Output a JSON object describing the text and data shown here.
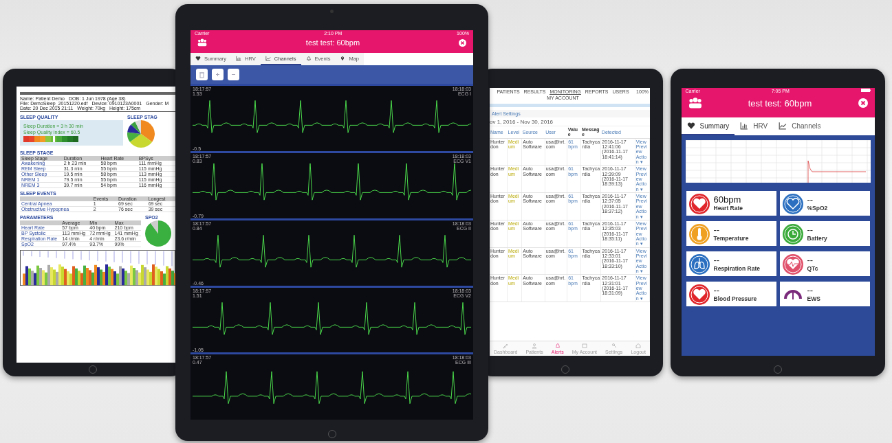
{
  "report_tablet": {
    "patient": [
      "Name: Patient Demo",
      "DOB: 1 Jun 1978 (Age 38)",
      "File: DemoSleep_20151220.edf",
      "Device: 0910123A0001",
      "Gender: M",
      "Date: 20 Dec 2015 21:11",
      "Weight: 70kg",
      "Height: 175cm"
    ],
    "sleep_quality": {
      "heading": "SLEEP QUALITY",
      "lines": [
        "Sleep Duration = 3 h 30 min",
        "Sleep Quality Index = 60.5"
      ],
      "level": 0.58
    },
    "sleep_stages_heading": "SLEEP STAG",
    "tables": [
      {
        "heading": "SLEEP STAGE",
        "columns": [
          "Sleep Stage",
          "Duration",
          "Heart Rate",
          "BPSys"
        ],
        "rows": [
          [
            "Awakening",
            "2 h 23 min",
            "58 bpm",
            "111 mmHg"
          ],
          [
            "REM Sleep",
            "31.3 min",
            "55 bpm",
            "115 mmHg"
          ],
          [
            "Other Sleep",
            "19.5 min",
            "58 bpm",
            "113 mmHg"
          ],
          [
            "NREM 1",
            "79.5 min",
            "55 bpm",
            "115 mmHg"
          ],
          [
            "NREM 3",
            "39.7 min",
            "54 bpm",
            "116 mmHg"
          ]
        ]
      },
      {
        "heading": "SLEEP EVENTS",
        "columns": [
          "",
          "Events",
          "Duration",
          "Longest"
        ],
        "rows": [
          [
            "Central Apnea",
            "1",
            "69 sec",
            "69 sec"
          ],
          [
            "Obstructive Hypopnea",
            "2",
            "76 sec",
            "39 sec"
          ]
        ]
      }
    ],
    "parameters": {
      "heading": "PARAMETERS",
      "columns": [
        "",
        "Average",
        "Min",
        "Max"
      ],
      "rows": [
        [
          "Heart Rate",
          "57 bpm",
          "40 bpm",
          "210 bpm"
        ],
        [
          "BP Systolic",
          "113 mmHg",
          "72 mmHg",
          "141 mmHg"
        ],
        [
          "Respiration Rate",
          "14 r/min",
          "4 r/min",
          "23.6 r/min"
        ],
        [
          "SpO2",
          "97.4%",
          "93.7%",
          "99%"
        ]
      ]
    },
    "spo2_heading": "SPO2"
  },
  "channels_tablet": {
    "status": {
      "carrier": "Carrier",
      "time": "2:10 PM",
      "battery": "100%"
    },
    "title": "test test: 60bpm",
    "tabs": [
      {
        "label": "Summary",
        "selected": false
      },
      {
        "label": "HRV",
        "selected": false
      },
      {
        "label": "Channels",
        "selected": true
      },
      {
        "label": "Events",
        "selected": false
      },
      {
        "label": "Map",
        "selected": false
      }
    ],
    "channels": [
      {
        "time_start": "18:17:57",
        "reading": "1.53",
        "time_end": "18:18:03",
        "lead": "ECG I",
        "scale": "-0.5"
      },
      {
        "time_start": "18:17:57",
        "reading": "0.83",
        "time_end": "18:18:03",
        "lead": "ECG V1",
        "scale": "-0.79"
      },
      {
        "time_start": "18:17:57",
        "reading": "0.84",
        "time_end": "18:18:03",
        "lead": "ECG II",
        "scale": "-0.46"
      },
      {
        "time_start": "18:17:57",
        "reading": "1.51",
        "time_end": "18:18:03",
        "lead": "ECG V2",
        "scale": "-1.05"
      },
      {
        "time_start": "18:17:57",
        "reading": "0.47",
        "time_end": "18:18:03",
        "lead": "ECG III"
      }
    ]
  },
  "alerts_tablet": {
    "battery": "100%",
    "nav": [
      {
        "label": "PATIENTS",
        "selected": false
      },
      {
        "label": "RESULTS",
        "selected": false
      },
      {
        "label": "MONITORING",
        "selected": true
      },
      {
        "label": "REPORTS",
        "selected": false
      },
      {
        "label": "USERS",
        "selected": false
      },
      {
        "label": "MY ACCOUNT",
        "selected": false
      }
    ],
    "breadcrumb": "Alert Settings",
    "date_range": "ov 1, 2016 - Nov 30, 2016",
    "columns": [
      "Name",
      "Level",
      "Source",
      "User",
      "Value",
      "Message",
      "Detected"
    ],
    "rows": [
      {
        "name": "Hunterdon",
        "level": "Medium",
        "source": "Auto Software",
        "user": "usa@hrt.com",
        "value": "61 bpm",
        "message": "Tachycardia",
        "detected": "2016-11-17 12:41:06",
        "detected_local": "(2016-11-17 18:41:14)",
        "actions": [
          "View",
          "Preview",
          "Action ▾"
        ]
      },
      {
        "name": "Hunterdon",
        "level": "Medium",
        "source": "Auto Software",
        "user": "usa@hrt.com",
        "value": "61 bpm",
        "message": "Tachycardia",
        "detected": "2016-11-17 12:39:09",
        "detected_local": "(2016-11-17 18:39:13)",
        "actions": [
          "View",
          "Preview",
          "Action ▾"
        ]
      },
      {
        "name": "Hunterdon",
        "level": "Medium",
        "source": "Auto Software",
        "user": "usa@hrt.com",
        "value": "61 bpm",
        "message": "Tachycardia",
        "detected": "2016-11-17 12:37:05",
        "detected_local": "(2016-11-17 18:37:12)",
        "actions": [
          "View",
          "Preview",
          "Action ▾"
        ]
      },
      {
        "name": "Hunterdon",
        "level": "Medium",
        "source": "Auto Software",
        "user": "usa@hrt.com",
        "value": "61 bpm",
        "message": "Tachycardia",
        "detected": "2016-11-17 12:35:03",
        "detected_local": "(2016-11-17 18:35:11)",
        "actions": [
          "View",
          "Preview",
          "Action ▾"
        ]
      },
      {
        "name": "Hunterdon",
        "level": "Medium",
        "source": "Auto Software",
        "user": "usa@hrt.com",
        "value": "61 bpm",
        "message": "Tachycardia",
        "detected": "2016-11-17 12:33:01",
        "detected_local": "(2016-11-17 18:33:10)",
        "actions": [
          "View",
          "Preview",
          "Action ▾"
        ]
      },
      {
        "name": "Hunterdon",
        "level": "Medium",
        "source": "Auto Software",
        "user": "usa@hrt.com",
        "value": "61 bpm",
        "message": "Tachycardia",
        "detected": "2016-11-17 12:31:01",
        "detected_local": "(2016-11-17 18:31:09)",
        "actions": [
          "View",
          "Preview",
          "Action ▾"
        ]
      }
    ],
    "bottom_tabs": [
      {
        "label": "Dashboard",
        "selected": false
      },
      {
        "label": "Patients",
        "selected": false
      },
      {
        "label": "Alerts",
        "selected": true
      },
      {
        "label": "My Account",
        "selected": false
      },
      {
        "label": "Settings",
        "selected": false
      },
      {
        "label": "Logout",
        "selected": false
      }
    ]
  },
  "summary_tablet": {
    "status": {
      "carrier": "Carrier",
      "time": "7:05 PM"
    },
    "title": "test test: 60bpm",
    "tabs": [
      {
        "label": "Summary",
        "selected": true
      },
      {
        "label": "HRV",
        "selected": false
      },
      {
        "label": "Channels",
        "selected": false
      }
    ],
    "tiles": [
      {
        "value": "60bpm",
        "label": "Heart Rate",
        "color": "#e0262b"
      },
      {
        "value": "--",
        "label": "%SpO2",
        "color": "#2a6fc0"
      },
      {
        "value": "--",
        "label": "Temperature",
        "color": "#f0a020"
      },
      {
        "value": "--",
        "label": "Battery",
        "color": "#3aaa3a"
      },
      {
        "value": "--",
        "label": "Respiration Rate",
        "color": "#2a6fc0"
      },
      {
        "value": "--",
        "label": "QTc",
        "color": "#e0506a"
      },
      {
        "value": "--",
        "label": "Blood Pressure",
        "color": "#e0262b"
      },
      {
        "value": "--",
        "label": "EWS",
        "color": "#7a2a7a"
      }
    ]
  }
}
